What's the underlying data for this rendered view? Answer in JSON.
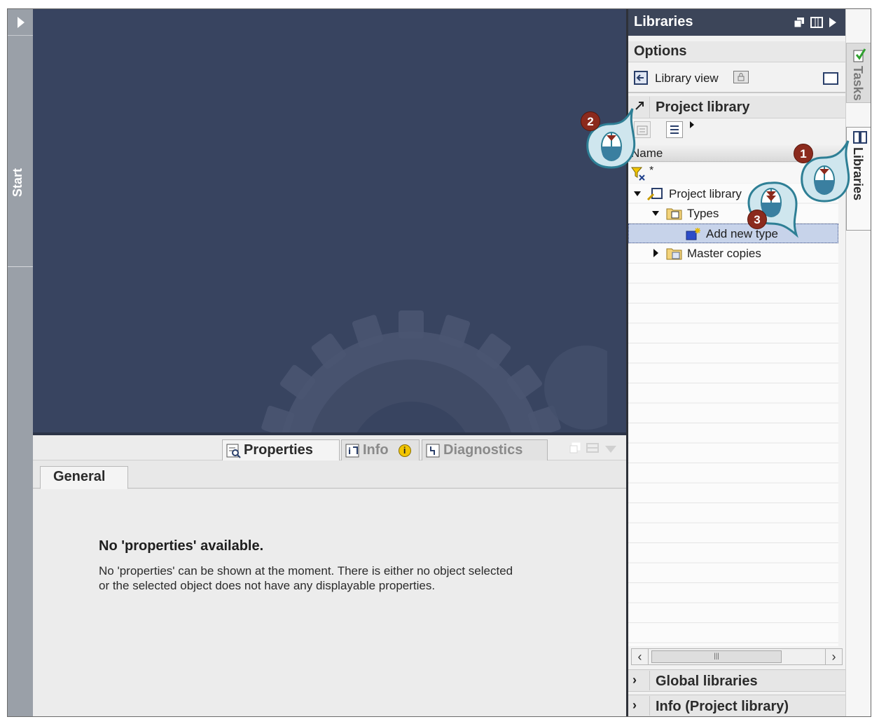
{
  "start_panel": {
    "label": "Start"
  },
  "inspector": {
    "tabs": [
      {
        "label": "Properties",
        "icon": "properties-icon",
        "active": true
      },
      {
        "label": "Info",
        "icon": "info-icon",
        "badge": "i",
        "active": false
      },
      {
        "label": "Diagnostics",
        "icon": "diagnostics-icon",
        "active": false
      }
    ],
    "general_tab": "General",
    "message_title": "No 'properties' available.",
    "message_text": "No 'properties' can be shown at the moment. There is either no object selected\nor the selected object does not have any displayable properties."
  },
  "libraries": {
    "title": "Libraries",
    "options_label": "Options",
    "library_view_label": "Library view",
    "project_library_section": "Project library",
    "column_name": "Name",
    "filter_text": "*",
    "tree": [
      {
        "label": "Project library",
        "icon": "project-library-icon",
        "expanded": true
      },
      {
        "label": "Types",
        "icon": "types-folder-icon",
        "expanded": true
      },
      {
        "label": "Add new type",
        "icon": "add-new-type-icon",
        "selected": true
      },
      {
        "label": "Master copies",
        "icon": "master-copies-folder-icon",
        "expanded": false
      }
    ],
    "scroll_thumb": "|||",
    "global_libraries": "Global libraries",
    "info_project_library": "Info (Project library)"
  },
  "right_tabs": [
    {
      "label": "Tasks",
      "active": false
    },
    {
      "label": "Libraries",
      "active": true
    }
  ],
  "callouts": [
    "1",
    "2",
    "3"
  ],
  "colors": {
    "portal_bg": "#384460",
    "header_bg": "#3c4559",
    "badge": "#8b2a1d",
    "callout": "#2e7f95",
    "selection": "#c7d3ea"
  }
}
